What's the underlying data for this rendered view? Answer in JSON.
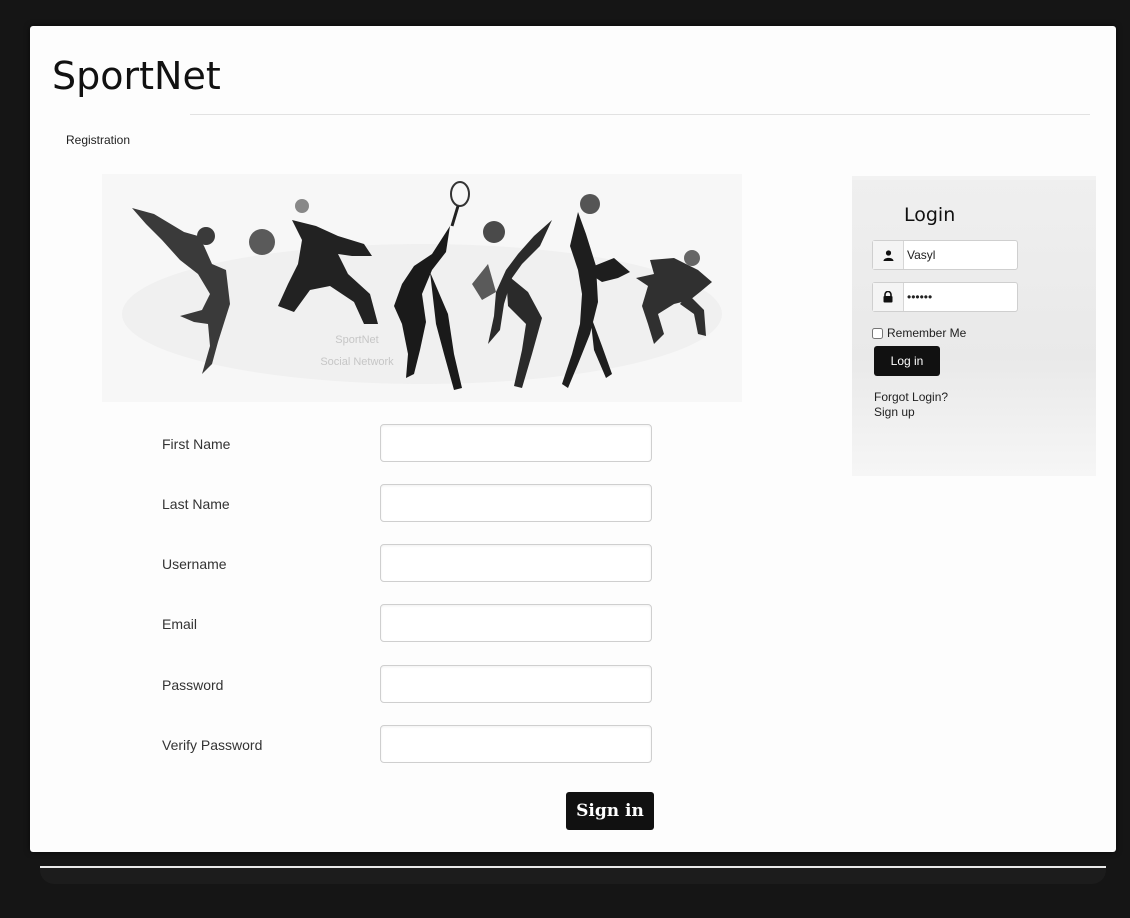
{
  "site": {
    "title": "SportNet",
    "breadcrumb": "Registration"
  },
  "banner": {
    "caption_line1": "SportNet",
    "caption_line2": "Social Network"
  },
  "registration": {
    "fields": [
      {
        "label": "First Name",
        "value": ""
      },
      {
        "label": "Last Name",
        "value": ""
      },
      {
        "label": "Username",
        "value": ""
      },
      {
        "label": "Email",
        "value": ""
      },
      {
        "label": "Password",
        "value": ""
      },
      {
        "label": "Verify Password",
        "value": ""
      }
    ],
    "submit_label": "Sign in"
  },
  "login": {
    "title": "Login",
    "username_value": "Vasyl",
    "password_value": "••••••",
    "username_icon": "user-icon",
    "password_icon": "lock-icon",
    "remember_label": "Remember Me",
    "remember_checked": false,
    "button_label": "Log in",
    "forgot_label": "Forgot Login?",
    "signup_label": "Sign up"
  },
  "colors": {
    "background": "#141414",
    "page": "#fdfdfd",
    "button": "#111111",
    "panel": "#ececec"
  }
}
